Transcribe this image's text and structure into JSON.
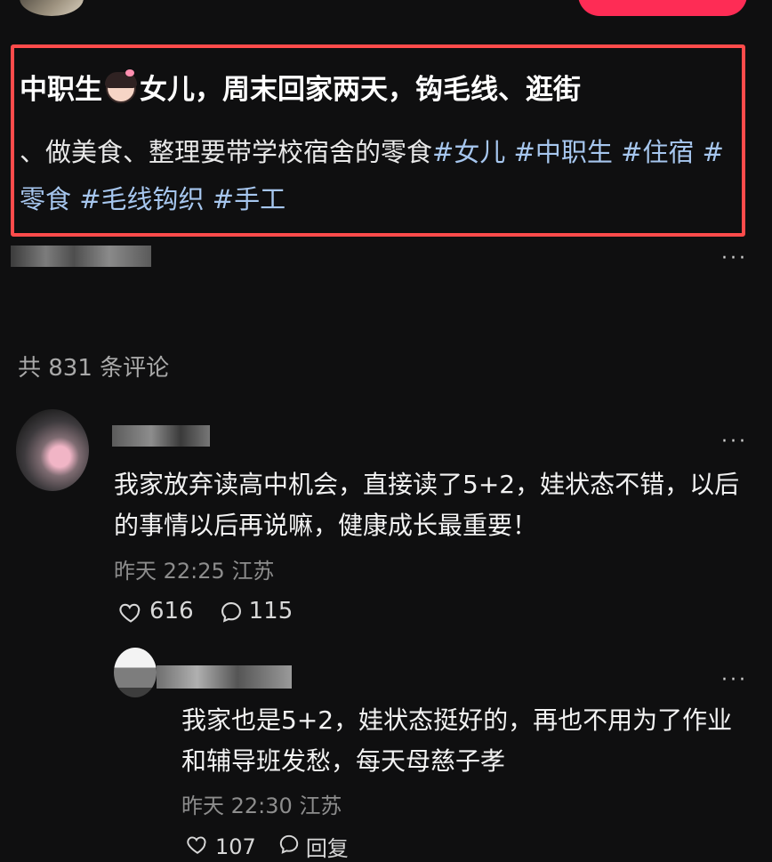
{
  "post": {
    "title_part1": "中职生",
    "title_emoji": "girl-face-emoji",
    "title_part2": "女儿，周末回家两天，钩毛线、逛街",
    "desc": "、做美食、整理要带学校宿舍的零食",
    "hashtags": [
      "#女儿",
      "#中职生",
      "#住宿",
      "#零食",
      "#毛线钩织",
      "#手工"
    ]
  },
  "comments_header": "共 831 条评论",
  "comment1": {
    "text": "我家放弃读高中机会，直接读了5+2，娃状态不错，以后的事情以后再说嘛，健康成长最重要！",
    "time": "昨天 22:25",
    "location": "江苏",
    "likes": "616",
    "replies": "115"
  },
  "reply1": {
    "text": "我家也是5+2，娃状态挺好的，再也不用为了作业和辅导班发愁，每天母慈子孝",
    "time": "昨天 22:30",
    "location": "江苏",
    "likes": "107",
    "reply_label": "回复"
  },
  "more_label": "···",
  "colors": {
    "background": "#0f0f10",
    "highlight_border": "#ff4b4b",
    "hashtag": "#a6c6ee",
    "follow_button": "#fe2c55"
  }
}
